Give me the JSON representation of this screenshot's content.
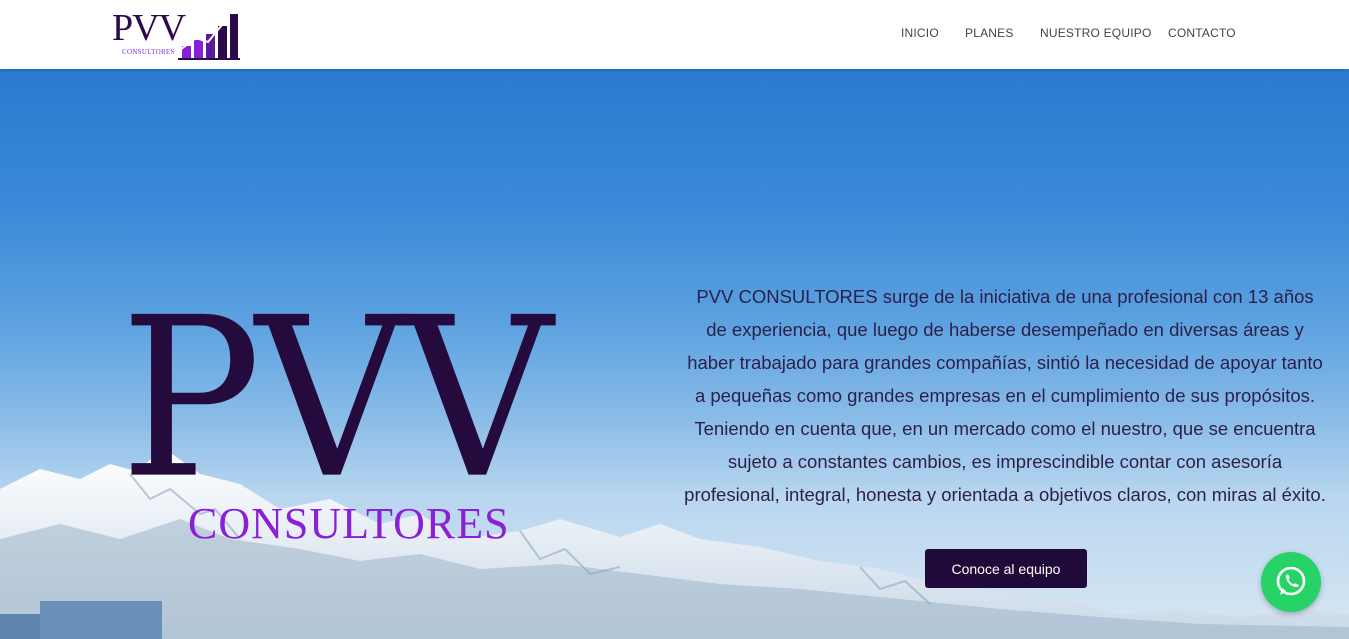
{
  "header": {
    "logo": {
      "title": "PVV",
      "subtitle": "CONSULTORES"
    },
    "nav": [
      {
        "label": "INICIO"
      },
      {
        "label": "PLANES"
      },
      {
        "label": "NUESTRO EQUIPO"
      },
      {
        "label": "CONTACTO"
      }
    ]
  },
  "hero": {
    "brand_title": "PVV",
    "brand_subtitle": "CONSULTORES",
    "description": "PVV CONSULTORES surge de la iniciativa de una profesional con 13 años de experiencia, que luego de haberse desempeñado en diversas áreas y haber trabajado para grandes compañías, sintió la necesidad de apoyar tanto a pequeñas como grandes empresas en el cumplimiento de sus propósitos. Teniendo en cuenta que, en un mercado como el nuestro, que se encuentra sujeto a constantes cambios, es imprescindible contar con asesoría profesional, integral, honesta y orientada a objetivos claros, con miras al éxito.",
    "cta_label": "Conoce al equipo"
  },
  "floating": {
    "whatsapp_icon": "whatsapp-icon"
  },
  "colors": {
    "brand_dark": "#250a3d",
    "brand_purple": "#8a1fd8",
    "whatsapp_green": "#25d366"
  }
}
